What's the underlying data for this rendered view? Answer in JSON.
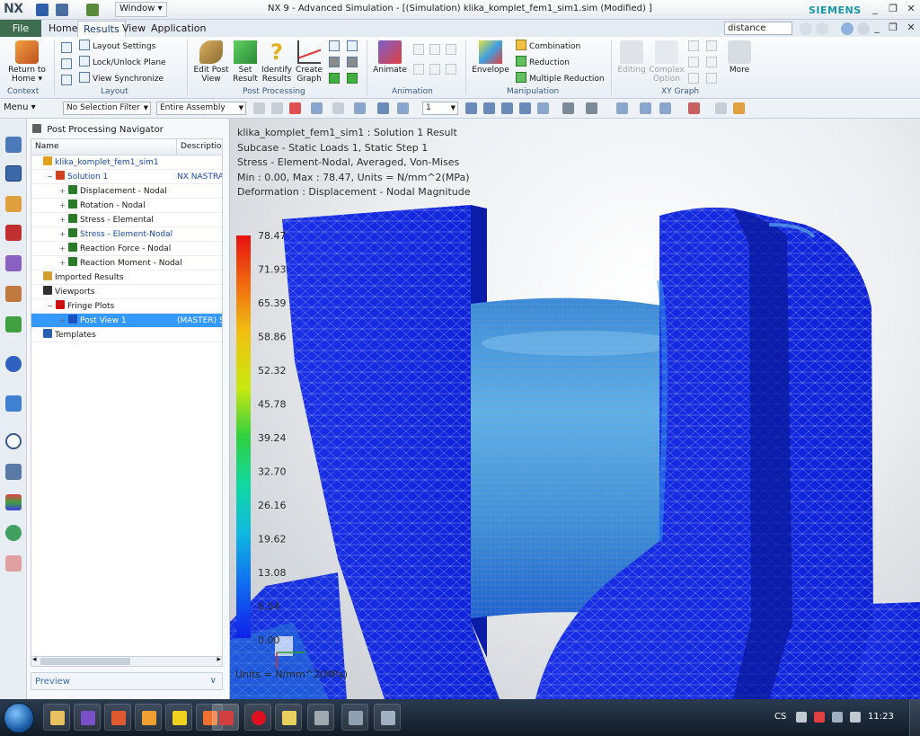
{
  "titlebar": {
    "logo": "NX",
    "window_menu": "Window ▾",
    "title": "NX 9 - Advanced Simulation - [(Simulation) klika_komplet_fem1_sim1.sim (Modified) ]",
    "brand": "SIEMENS",
    "minimize": "_",
    "restore": "❐",
    "close": "✕"
  },
  "ribbon_tabs": {
    "file": "File",
    "tabs": [
      "Home",
      "Results",
      "View",
      "Application"
    ],
    "active": "Results",
    "search_value": "distance",
    "sub_min": "_",
    "sub_restore": "❐",
    "sub_close": "✕"
  },
  "ribbon": {
    "context": {
      "label": "Context",
      "return_home": "Return to Home ▾"
    },
    "layout": {
      "label": "Layout",
      "items": [
        "Layout Settings",
        "Lock/Unlock Plane",
        "View Synchronize"
      ]
    },
    "post": {
      "label": "Post Processing",
      "buttons": [
        "Edit Post View",
        "Set Result",
        "Identify Results",
        "Create Graph"
      ]
    },
    "animation": {
      "label": "Animation",
      "button": "Animate"
    },
    "manipulation": {
      "label": "Manipulation",
      "envelope": "Envelope",
      "items": [
        "Combination",
        "Reduction",
        "Multiple Reduction"
      ]
    },
    "xy": {
      "label": "XY Graph",
      "buttons": [
        "Editing",
        "Complex Option"
      ],
      "more": "More"
    }
  },
  "toolbar": {
    "menu": "Menu ▾",
    "selection_filter": "No Selection Filter",
    "scope": "Entire Assembly",
    "step_value": "1"
  },
  "navigator": {
    "title": "Post Processing Navigator",
    "columns": [
      "Name",
      "Description"
    ],
    "rows": [
      {
        "label": "klika_komplet_fem1_sim1",
        "desc": "",
        "indent": 0,
        "expander": "",
        "color": "#e0a020",
        "style": "link"
      },
      {
        "label": "Solution 1",
        "desc": "NX NASTRAN",
        "indent": 1,
        "expander": "−",
        "color": "#d04020",
        "style": "link"
      },
      {
        "label": "Displacement - Nodal",
        "desc": "",
        "indent": 2,
        "expander": "+",
        "color": "#2a7a2a",
        "style": ""
      },
      {
        "label": "Rotation - Nodal",
        "desc": "",
        "indent": 2,
        "expander": "+",
        "color": "#2a7a2a",
        "style": ""
      },
      {
        "label": "Stress - Elemental",
        "desc": "",
        "indent": 2,
        "expander": "+",
        "color": "#2a7a2a",
        "style": ""
      },
      {
        "label": "Stress - Element-Nodal",
        "desc": "",
        "indent": 2,
        "expander": "+",
        "color": "#2a7a2a",
        "style": "link"
      },
      {
        "label": "Reaction Force - Nodal",
        "desc": "",
        "indent": 2,
        "expander": "+",
        "color": "#2a7a2a",
        "style": ""
      },
      {
        "label": "Reaction Moment - Nodal",
        "desc": "",
        "indent": 2,
        "expander": "+",
        "color": "#2a7a2a",
        "style": ""
      },
      {
        "label": "Imported Results",
        "desc": "",
        "indent": 0,
        "expander": "",
        "color": "#d0a030",
        "style": ""
      },
      {
        "label": "Viewports",
        "desc": "",
        "indent": 0,
        "expander": "",
        "color": "#303030",
        "style": ""
      },
      {
        "label": "Fringe Plots",
        "desc": "",
        "indent": 1,
        "expander": "−",
        "color": "#cc1010",
        "style": ""
      },
      {
        "label": "Post View 1",
        "desc": "(MASTER) S",
        "indent": 2,
        "expander": "+",
        "color": "#1a50c0",
        "style": "sel"
      },
      {
        "label": "Templates",
        "desc": "",
        "indent": 0,
        "expander": "",
        "color": "#2a60b0",
        "style": ""
      }
    ],
    "preview": "Preview",
    "preview_chevron": "∨",
    "scroll_left": "◂",
    "scroll_right": "▸"
  },
  "viewport": {
    "info_lines": [
      "klika_komplet_fem1_sim1 : Solution 1 Result",
      "Subcase - Static Loads 1, Static Step 1",
      "Stress - Element-Nodal, Averaged, Von-Mises",
      "Min : 0.00, Max : 78.47, Units = N/mm^2(MPa)",
      "Deformation : Displacement - Nodal Magnitude"
    ],
    "legend_values": [
      "78.47",
      "71.93",
      "65.39",
      "58.86",
      "52.32",
      "45.78",
      "39.24",
      "32.70",
      "26.16",
      "19.62",
      "13.08",
      "6.54",
      "0.00"
    ],
    "units": "Units = N/mm^2(MPa)"
  },
  "taskbar": {
    "lang": "CS",
    "clock": "11:23"
  }
}
